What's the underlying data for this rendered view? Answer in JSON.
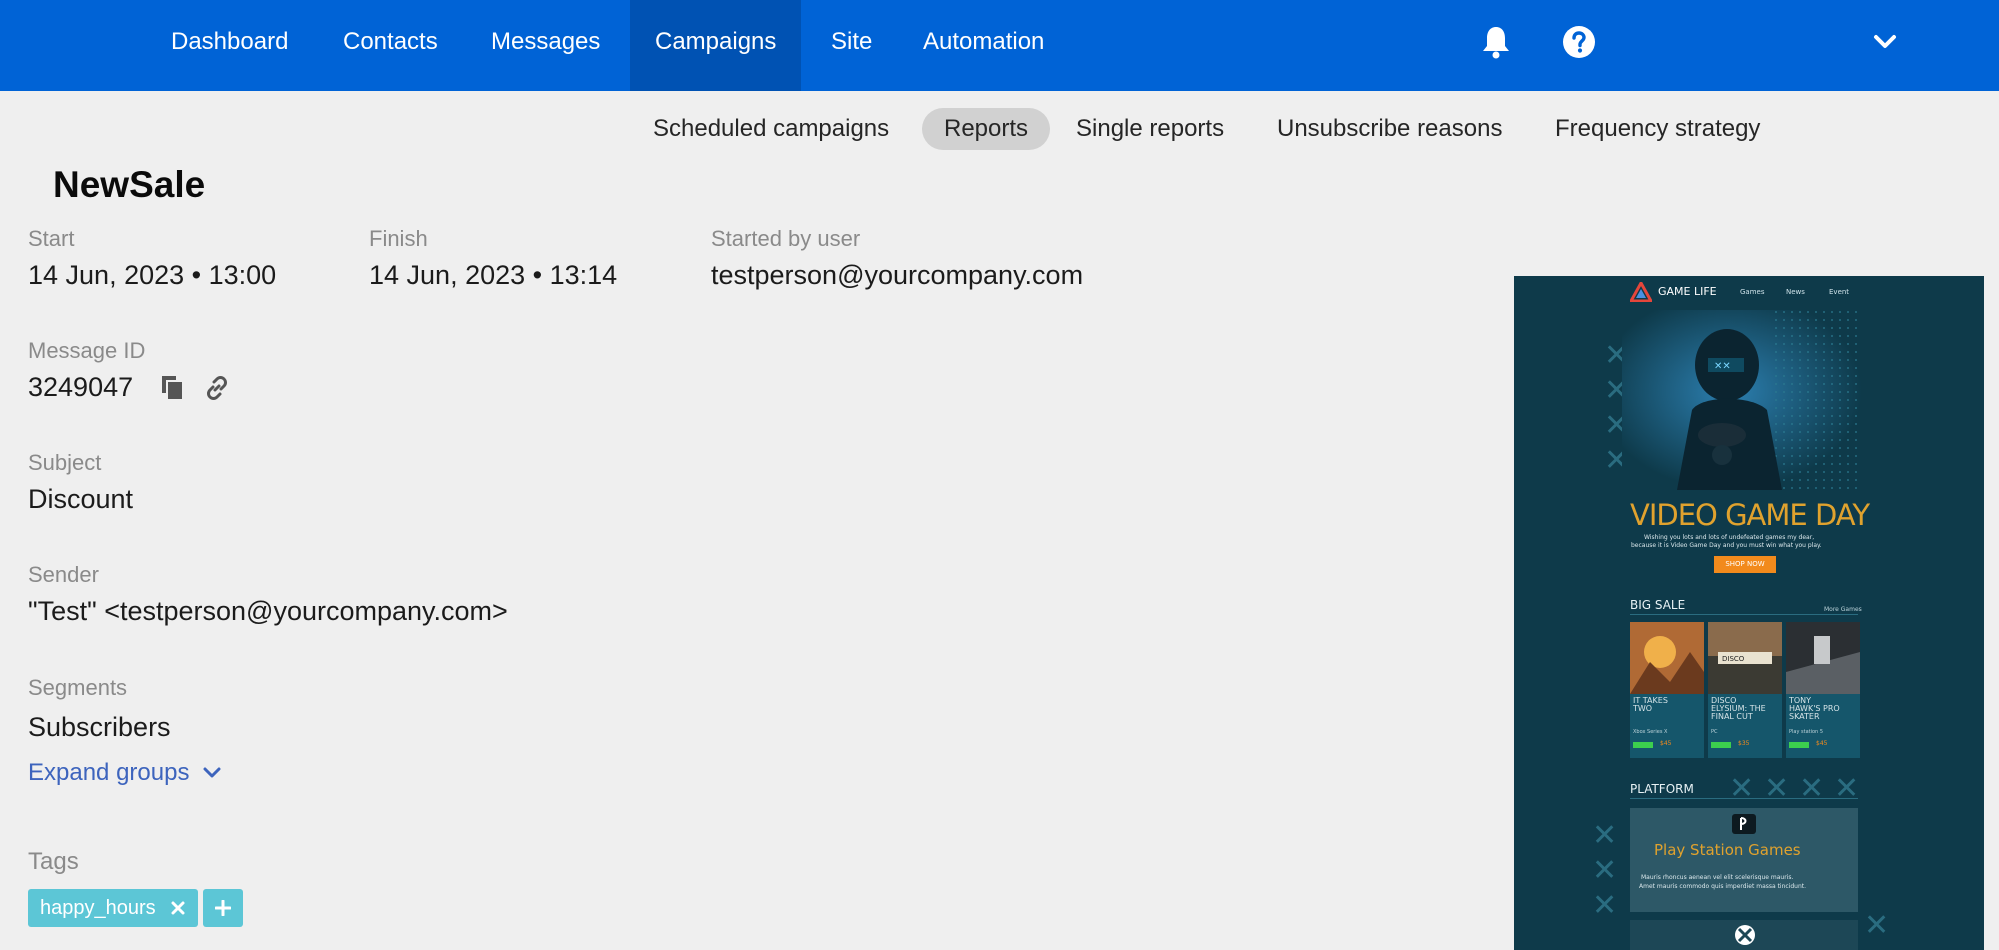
{
  "nav": {
    "items": [
      {
        "label": "Dashboard"
      },
      {
        "label": "Contacts"
      },
      {
        "label": "Messages"
      },
      {
        "label": "Campaigns"
      },
      {
        "label": "Site"
      },
      {
        "label": "Automation"
      }
    ],
    "active": "Campaigns",
    "icons": [
      "bell-icon",
      "help-icon",
      "chevron-down-icon"
    ],
    "color": "#0063d6"
  },
  "subnav": {
    "items": [
      {
        "label": "Scheduled campaigns"
      },
      {
        "label": "Reports"
      },
      {
        "label": "Single reports"
      },
      {
        "label": "Unsubscribe reasons"
      },
      {
        "label": "Frequency strategy"
      }
    ],
    "active": "Reports"
  },
  "campaign": {
    "title": "NewSale",
    "start_label": "Start",
    "start_value": "14 Jun, 2023 • 13:00",
    "finish_label": "Finish",
    "finish_value": "14 Jun, 2023 • 13:14",
    "user_label": "Started by user",
    "user_value": "testperson@yourcompany.com",
    "message_id_label": "Message ID",
    "message_id_value": "3249047",
    "subject_label": "Subject",
    "subject_value": "Discount",
    "sender_label": "Sender",
    "sender_value": "\"Test\" <testperson@yourcompany.com>",
    "segments_label": "Segments",
    "segments_value": "Subscribers",
    "expand_label": "Expand groups",
    "tags_label": "Tags",
    "tags": [
      {
        "label": "happy_hours"
      }
    ]
  },
  "preview": {
    "brand": "GAME LIFE",
    "menu": [
      "Games",
      "News",
      "Event"
    ],
    "hero_title": "VIDEO GAME DAY",
    "hero_text_1": "Wishing you lots and lots of undefeated games my dear,",
    "hero_text_2": "because it is Video Game Day and you must win what you play.",
    "cta": "SHOP NOW",
    "sale_title": "BIG SALE",
    "sale_more": "More Games",
    "games": [
      {
        "title_1": "IT TAKES",
        "title_2": "TWO",
        "title_3": "",
        "platform": "Xbox Series X",
        "price": "$45"
      },
      {
        "title_1": "DISCO",
        "title_2": "ELYSIUM: THE",
        "title_3": "FINAL CUT",
        "platform": "PC",
        "price": "$35"
      },
      {
        "title_1": "TONY",
        "title_2": "HAWK'S PRO",
        "title_3": "SKATER",
        "platform": "Play station 5",
        "price": "$45"
      }
    ],
    "platform_title": "PLATFORM",
    "ps_title": "Play Station Games",
    "ps_text_1": "Mauris rhoncus aenean vel elit scelerisque mauris.",
    "ps_text_2": "Amet mauris commodo quis imperdiet massa tincidunt."
  }
}
